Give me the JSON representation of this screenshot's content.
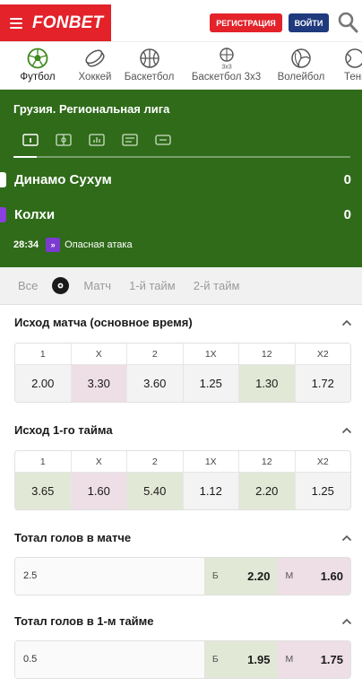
{
  "header": {
    "logo": "FONBET",
    "register_label": "РЕГИСТРАЦИЯ",
    "login_label": "ВОЙТИ"
  },
  "sports": [
    {
      "label": "Футбол",
      "icon": "football-icon",
      "active": true
    },
    {
      "label": "Хоккей",
      "icon": "hockey-puck-icon",
      "active": false
    },
    {
      "label": "Баскетбол",
      "icon": "basketball-icon",
      "active": false
    },
    {
      "label": "Баскетбол 3x3",
      "icon": "basketball-3x3-icon",
      "badge": "3x3",
      "active": false
    },
    {
      "label": "Волейбол",
      "icon": "volleyball-icon",
      "active": false
    },
    {
      "label": "Тенн",
      "icon": "tennis-icon",
      "active": false
    }
  ],
  "match": {
    "league": "Грузия. Региональная лига",
    "home": {
      "name": "Динамо Сухум",
      "score": "0",
      "color": "#ffffff"
    },
    "away": {
      "name": "Колхи",
      "score": "0",
      "color": "#8a3fe0"
    },
    "time": "28:34",
    "status_icon_text": "»",
    "status": "Опасная атака"
  },
  "market_tabs": [
    "Все",
    "Матч",
    "1-й тайм",
    "2-й тайм"
  ],
  "markets": {
    "match_result": {
      "title": "Исход матча (основное время)",
      "headers": [
        "1",
        "X",
        "2",
        "1X",
        "12",
        "X2"
      ],
      "odds": [
        "2.00",
        "3.30",
        "3.60",
        "1.25",
        "1.30",
        "1.72"
      ]
    },
    "first_half_result": {
      "title": "Исход 1-го тайма",
      "headers": [
        "1",
        "X",
        "2",
        "1X",
        "12",
        "X2"
      ],
      "odds": [
        "3.65",
        "1.60",
        "5.40",
        "1.12",
        "2.20",
        "1.25"
      ]
    },
    "total_goals": {
      "title": "Тотал голов в матче",
      "line": "2.5",
      "over_label": "Б",
      "over_odd": "2.20",
      "under_label": "М",
      "under_odd": "1.60"
    },
    "total_goals_first_half": {
      "title": "Тотал голов в 1-м тайме",
      "line": "0.5",
      "over_label": "Б",
      "over_odd": "1.95",
      "under_label": "М",
      "under_odd": "1.75"
    }
  },
  "colors": {
    "brand_red": "#e3222a",
    "login_blue": "#1f3a7d",
    "match_green": "#2f6b19",
    "odd_pink": "#eedee6",
    "odd_green": "#e2e8d6"
  }
}
